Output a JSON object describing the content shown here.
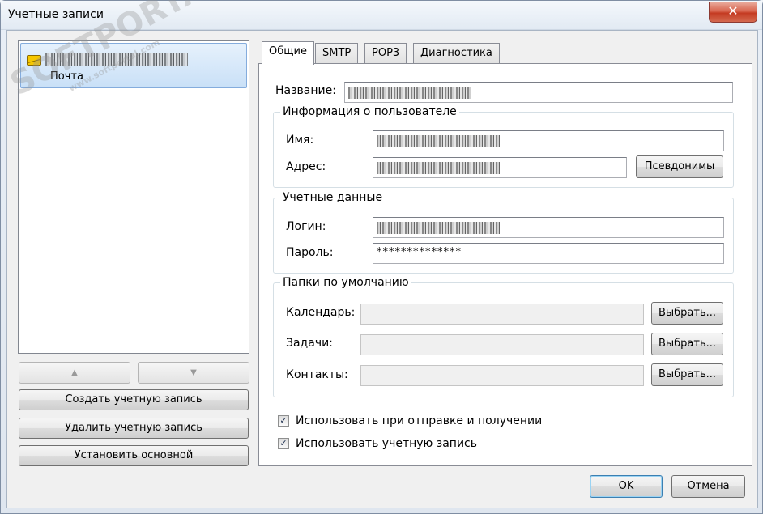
{
  "window": {
    "title": "Учетные записи",
    "close_glyph": "✕"
  },
  "accounts": {
    "items": [
      {
        "subtitle": "Почта",
        "icon": "envelope-icon"
      }
    ],
    "up_glyph": "▲",
    "down_glyph": "▼",
    "create_label": "Создать учетную запись",
    "delete_label": "Удалить учетную запись",
    "set_default_label": "Установить основной"
  },
  "tabs": [
    {
      "label": "Общие",
      "active": true
    },
    {
      "label": "SMTP",
      "active": false
    },
    {
      "label": "POP3",
      "active": false
    },
    {
      "label": "Диагностика",
      "active": false
    }
  ],
  "general": {
    "name_label": "Название:",
    "user_info": {
      "title": "Информация о пользователе",
      "name_label": "Имя:",
      "address_label": "Адрес:",
      "aliases_label": "Псевдонимы"
    },
    "credentials": {
      "title": "Учетные данные",
      "login_label": "Логин:",
      "password_label": "Пароль:",
      "password_value": "**************"
    },
    "folders": {
      "title": "Папки по умолчанию",
      "calendar_label": "Календарь:",
      "tasks_label": "Задачи:",
      "contacts_label": "Контакты:",
      "choose_label": "Выбрать..."
    },
    "use_for_send_receive": {
      "label": "Использовать при отправке и получении",
      "checked": true
    },
    "use_account": {
      "label": "Использовать учетную запись",
      "checked": true
    },
    "check_glyph": "✓"
  },
  "footer": {
    "ok_label": "OK",
    "cancel_label": "Отмена"
  },
  "watermark": {
    "text": "SOFTPORTAL",
    "sub": "www.softportal.com"
  }
}
